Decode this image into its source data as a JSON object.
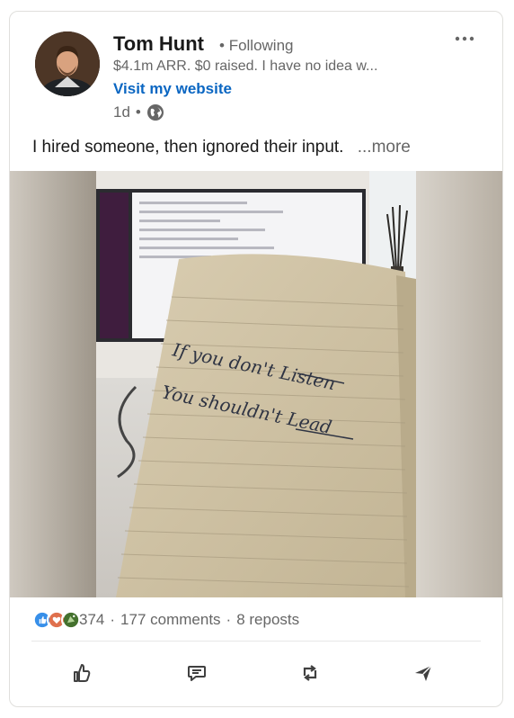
{
  "author": {
    "name": "Tom Hunt",
    "follow_status": "Following",
    "separator": "•",
    "headline": "$4.1m ARR. $0 raised. I have no idea w...",
    "website_label": "Visit my website",
    "time": "1d",
    "visibility_icon": "globe-icon"
  },
  "post": {
    "text": "I hired someone, then ignored their input.",
    "see_more": "...more",
    "image": {
      "handwriting_line1": "If you don't Listen",
      "handwriting_line2": "You shouldn't Lead"
    }
  },
  "social": {
    "reaction_icons": [
      "like-icon",
      "love-icon",
      "celebrate-icon"
    ],
    "reaction_count": "374",
    "comments": "177 comments",
    "reposts": "8 reposts",
    "dot": "·"
  },
  "actions": [
    {
      "name": "like",
      "icon": "thumbs-up-icon"
    },
    {
      "name": "comment",
      "icon": "comment-icon"
    },
    {
      "name": "repost",
      "icon": "repost-icon"
    },
    {
      "name": "send",
      "icon": "send-icon"
    }
  ],
  "colors": {
    "link": "#0a66c2",
    "secondary_text": "#666666",
    "like": "#378fe9",
    "love": "#df704d",
    "celebrate": "#44712e"
  }
}
